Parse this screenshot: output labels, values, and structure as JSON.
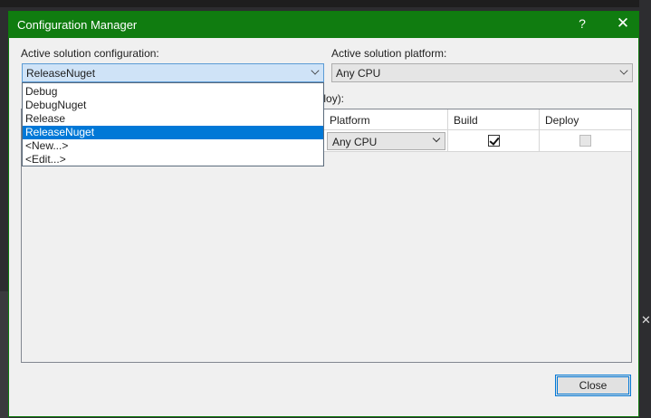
{
  "dialog": {
    "title": "Configuration Manager",
    "help_glyph": "?",
    "close_glyph": "✕"
  },
  "config": {
    "label": "Active solution configuration:",
    "selected": "ReleaseNuget",
    "options": [
      "Debug",
      "DebugNuget",
      "Release",
      "ReleaseNuget",
      "<New...>",
      "<Edit...>"
    ],
    "highlighted_index": 3
  },
  "platform": {
    "label": "Active solution platform:",
    "selected": "Any CPU"
  },
  "contexts": {
    "label_visible_fragment": "eploy):",
    "columns": [
      "Platform",
      "Build",
      "Deploy"
    ],
    "rows": [
      {
        "platform": "Any CPU",
        "build": true,
        "deploy": false
      }
    ]
  },
  "buttons": {
    "close": "Close"
  },
  "background": {
    "right_edge_glyph": "✕"
  }
}
